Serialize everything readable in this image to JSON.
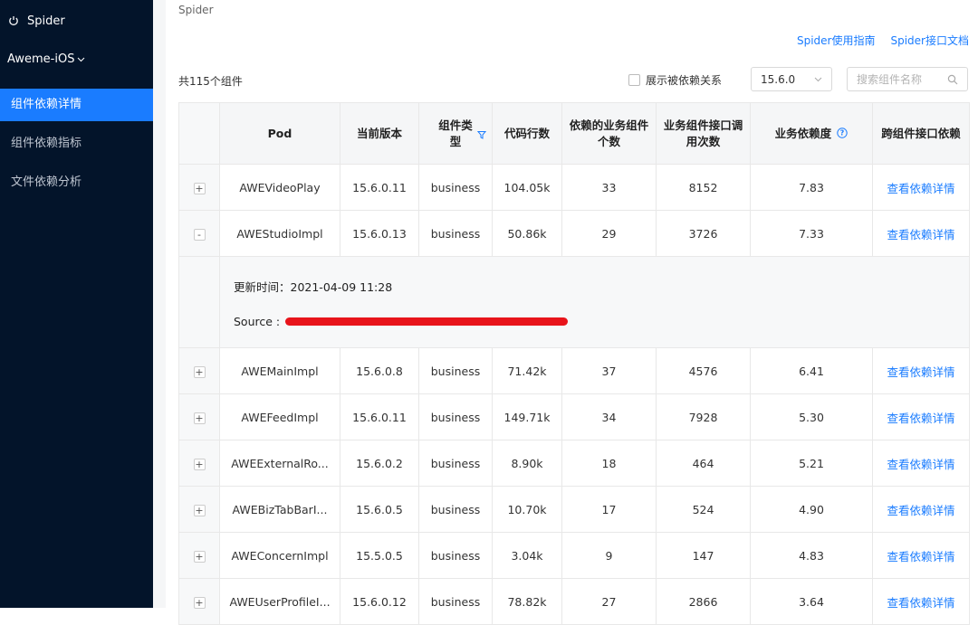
{
  "sidebar": {
    "brand": "Spider",
    "app": "Aweme-iOS",
    "items": [
      {
        "label": "组件依赖详情",
        "active": true
      },
      {
        "label": "组件依赖指标",
        "active": false
      },
      {
        "label": "文件依赖分析",
        "active": false
      }
    ]
  },
  "breadcrumb": "Spider",
  "links": {
    "guide": "Spider使用指南",
    "api_docs": "Spider接口文档"
  },
  "toolbar": {
    "count": "共115个组件",
    "show_dependents_label": "展示被依赖关系",
    "version": "15.6.0",
    "search_placeholder": "搜索组件名称"
  },
  "table": {
    "headers": [
      "Pod",
      "当前版本",
      "组件类型",
      "代码行数",
      "依赖的业务组件个数",
      "业务组件接口调用次数",
      "业务依赖度",
      "跨组件接口依赖"
    ],
    "rows": [
      {
        "expander": "+",
        "pod": "AWEVideoPlay",
        "version": "15.6.0.11",
        "type": "business",
        "lines": "104.05k",
        "deps": "33",
        "calls": "8152",
        "degree": "7.83",
        "action": "查看依赖详情"
      },
      {
        "expander": "-",
        "pod": "AWEStudioImpl",
        "version": "15.6.0.13",
        "type": "business",
        "lines": "50.86k",
        "deps": "29",
        "calls": "3726",
        "degree": "7.33",
        "action": "查看依赖详情"
      },
      {
        "expander": "+",
        "pod": "AWEMainImpl",
        "version": "15.6.0.8",
        "type": "business",
        "lines": "71.42k",
        "deps": "37",
        "calls": "4576",
        "degree": "6.41",
        "action": "查看依赖详情"
      },
      {
        "expander": "+",
        "pod": "AWEFeedImpl",
        "version": "15.6.0.11",
        "type": "business",
        "lines": "149.71k",
        "deps": "34",
        "calls": "7928",
        "degree": "5.30",
        "action": "查看依赖详情"
      },
      {
        "expander": "+",
        "pod": "AWEExternalRo...",
        "version": "15.6.0.2",
        "type": "business",
        "lines": "8.90k",
        "deps": "18",
        "calls": "464",
        "degree": "5.21",
        "action": "查看依赖详情"
      },
      {
        "expander": "+",
        "pod": "AWEBizTabBarI...",
        "version": "15.6.0.5",
        "type": "business",
        "lines": "10.70k",
        "deps": "17",
        "calls": "524",
        "degree": "4.90",
        "action": "查看依赖详情"
      },
      {
        "expander": "+",
        "pod": "AWEConcernImpl",
        "version": "15.5.0.5",
        "type": "business",
        "lines": "3.04k",
        "deps": "9",
        "calls": "147",
        "degree": "4.83",
        "action": "查看依赖详情"
      },
      {
        "expander": "+",
        "pod": "AWEUserProfileI...",
        "version": "15.6.0.12",
        "type": "business",
        "lines": "78.82k",
        "deps": "27",
        "calls": "2866",
        "degree": "3.64",
        "action": "查看依赖详情"
      }
    ],
    "detail": {
      "update_time": "更新时间：2021-04-09 11:28",
      "source_label": "Source :"
    }
  },
  "colors": {
    "accent": "#1a7cff",
    "sidebar_bg": "#03142a",
    "redaction": "#e8141b"
  }
}
